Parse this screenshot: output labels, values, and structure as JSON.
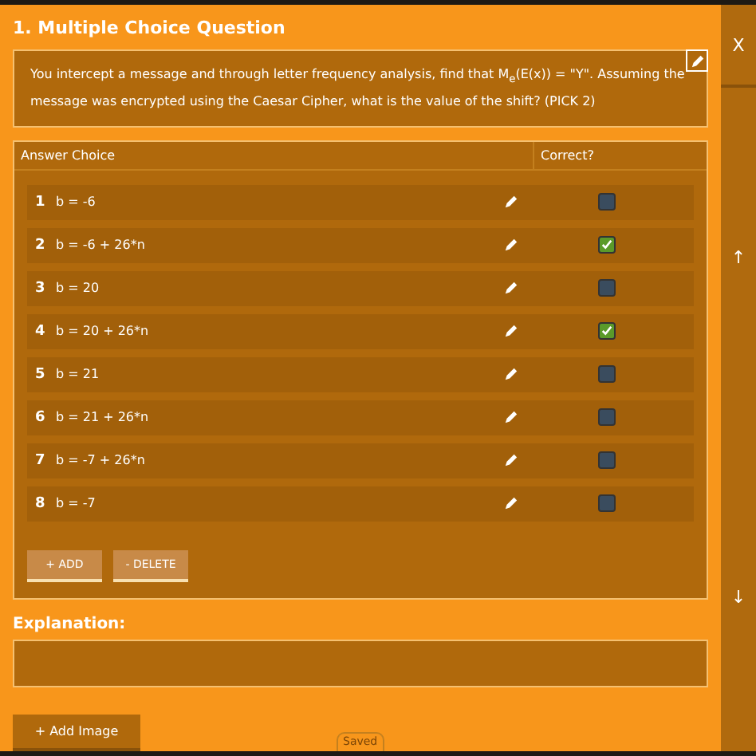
{
  "title": "1. Multiple Choice Question",
  "question": "You intercept a message and through letter frequency analysis, find that M$_{e}$(E(x)) = \"Y\". Assuming the message was encrypted using the Caesar Cipher, what is the value of the shift? (PICK 2)",
  "table": {
    "columns": [
      "Answer Choice",
      "Correct?"
    ],
    "rows": [
      {
        "number": "1",
        "answer": "b = -6",
        "checked": false
      },
      {
        "number": "2",
        "answer": "b = -6 + 26*n",
        "checked": true
      },
      {
        "number": "3",
        "answer": "b = 20",
        "checked": false
      },
      {
        "number": "4",
        "answer": "b = 20 + 26*n",
        "checked": true
      },
      {
        "number": "5",
        "answer": "b = 21",
        "checked": false
      },
      {
        "number": "6",
        "answer": "b = 21 + 26*n",
        "checked": false
      },
      {
        "number": "7",
        "answer": "b = -7 + 26*n",
        "checked": false
      },
      {
        "number": "8",
        "answer": "b = -7",
        "checked": false
      }
    ],
    "buttons": [
      "+ ADD",
      "- DELETE"
    ]
  },
  "explanation": {
    "label": "Explanation:"
  },
  "add_image": "+ Add Image",
  "status": "Saved",
  "sidebar": {
    "close": "X",
    "up": "↑",
    "down": "↓"
  }
}
